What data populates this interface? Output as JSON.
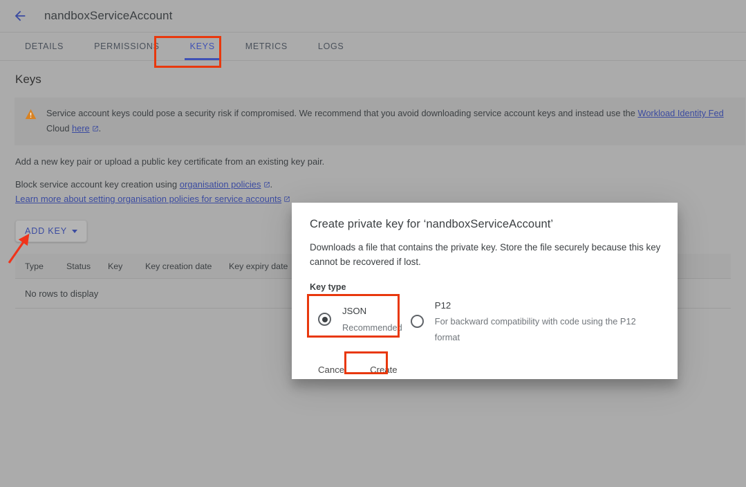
{
  "header": {
    "back_icon": "back-arrow-icon",
    "title": "nandboxServiceAccount"
  },
  "tabs": [
    {
      "label": "DETAILS",
      "active": false
    },
    {
      "label": "PERMISSIONS",
      "active": false
    },
    {
      "label": "KEYS",
      "active": true
    },
    {
      "label": "METRICS",
      "active": false
    },
    {
      "label": "LOGS",
      "active": false
    }
  ],
  "main": {
    "section_title": "Keys",
    "banner": {
      "icon": "warning-triangle-icon",
      "text_part1": "Service account keys could pose a security risk if compromised. We recommend that you avoid downloading service account keys and instead use the ",
      "link1": "Workload Identity Fed",
      "text_part2": "Cloud ",
      "link2": "here",
      "text_part3": "."
    },
    "para1": "Add a new key pair or upload a public key certificate from an existing key pair.",
    "para2_prefix": "Block service account key creation using ",
    "para2_link": "organisation policies",
    "para2_suffix": ".",
    "para3_link": "Learn more about setting organisation policies for service accounts",
    "add_key_button": "ADD KEY",
    "table": {
      "columns": [
        "Type",
        "Status",
        "Key",
        "Key creation date",
        "Key expiry date"
      ],
      "empty_message": "No rows to display"
    }
  },
  "dialog": {
    "title": "Create private key for ‘nandboxServiceAccount’",
    "description": "Downloads a file that contains the private key. Store the file securely because this key cannot be recovered if lost.",
    "keytype_label": "Key type",
    "options": [
      {
        "value": "JSON",
        "sub": "Recommended",
        "selected": true
      },
      {
        "value": "P12",
        "sub": "For backward compatibility with code using the P12 format",
        "selected": false
      }
    ],
    "cancel_label": "Cancel",
    "create_label": "Create"
  },
  "colors": {
    "accent_blue": "#3f51b5",
    "link_blue": "#3b4ba0",
    "annotation_red": "#e8380d",
    "warning_orange": "#d98221",
    "page_gray": "#ababab"
  }
}
